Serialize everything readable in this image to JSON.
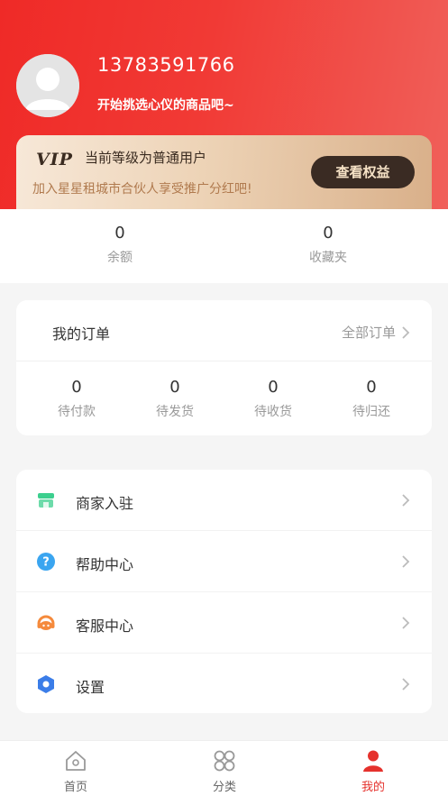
{
  "profile": {
    "phone": "13783591766",
    "tagline": "开始挑选心仪的商品吧~"
  },
  "vip": {
    "logo_text": "VIP",
    "level": "当前等级为普通用户",
    "desc": "加入星星租城市合伙人享受推广分红吧!",
    "button": "查看权益"
  },
  "stats": [
    {
      "value": "0",
      "label": "余额"
    },
    {
      "value": "0",
      "label": "收藏夹"
    }
  ],
  "orders": {
    "title": "我的订单",
    "all_label": "全部订单",
    "items": [
      {
        "value": "0",
        "label": "待付款"
      },
      {
        "value": "0",
        "label": "待发货"
      },
      {
        "value": "0",
        "label": "待收货"
      },
      {
        "value": "0",
        "label": "待归还"
      }
    ]
  },
  "menu": [
    {
      "label": "商家入驻",
      "icon": "store-icon",
      "color": "#3ccf8e"
    },
    {
      "label": "帮助中心",
      "icon": "help-icon",
      "color": "#3aa5f0"
    },
    {
      "label": "客服中心",
      "icon": "headset-icon",
      "color": "#f58a3c"
    },
    {
      "label": "设置",
      "icon": "settings-hexagon-icon",
      "color": "#3b7de8"
    }
  ],
  "tabbar": [
    {
      "label": "首页",
      "icon": "home-icon",
      "active": false
    },
    {
      "label": "分类",
      "icon": "category-icon",
      "active": false
    },
    {
      "label": "我的",
      "icon": "user-icon",
      "active": true
    }
  ],
  "colors": {
    "header_red": "#ef2a27",
    "accent": "#e5322d",
    "vip_button": "#3a2b23"
  }
}
